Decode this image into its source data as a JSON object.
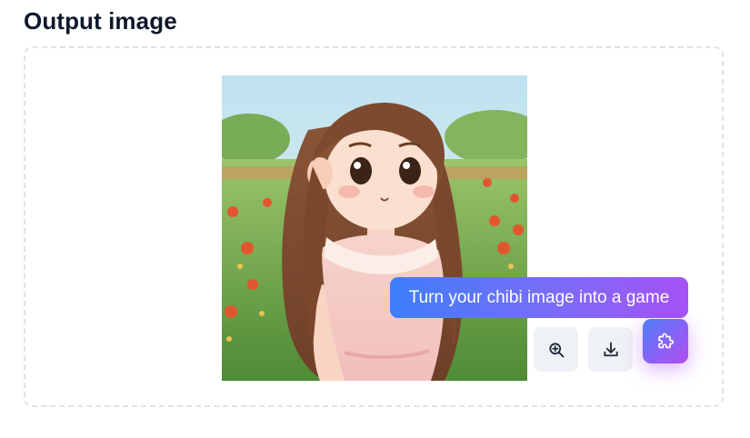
{
  "section": {
    "title": "Output image"
  },
  "output": {
    "image_alt": "Chibi-style illustration of a girl with long brown hair and a pink lace dress in a tulip field"
  },
  "tooltip": {
    "text": "Turn your chibi image into a game"
  },
  "actions": [
    {
      "icon": "zoom-in-icon",
      "label": "Zoom"
    },
    {
      "icon": "download-icon",
      "label": "Download"
    },
    {
      "icon": "puzzle-icon",
      "label": "Turn into game"
    }
  ],
  "colors": {
    "accent_blue": "#3d7ef9",
    "accent_purple": "#a652f3",
    "button_bg": "#eef1f5",
    "frame_border": "#dfe3e8"
  }
}
